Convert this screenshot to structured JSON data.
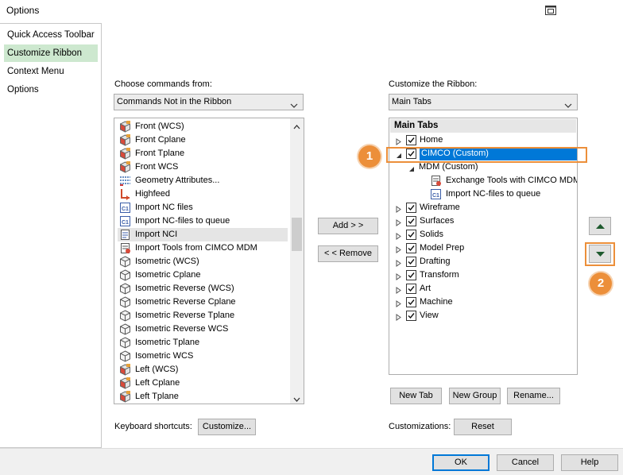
{
  "window": {
    "title": "Options"
  },
  "sidebar": {
    "items": [
      {
        "label": "Quick Access Toolbar",
        "selected": false
      },
      {
        "label": "Customize Ribbon",
        "selected": true
      },
      {
        "label": "Context Menu",
        "selected": false
      },
      {
        "label": "Options",
        "selected": false
      }
    ]
  },
  "left_panel": {
    "label": "Choose commands from:",
    "combo_value": "Commands Not in the Ribbon",
    "commands": [
      {
        "label": "Front (WCS)",
        "icon": "cube-red-icon"
      },
      {
        "label": "Front Cplane",
        "icon": "cube-red-icon"
      },
      {
        "label": "Front Tplane",
        "icon": "cube-red-icon"
      },
      {
        "label": "Front WCS",
        "icon": "cube-red-icon"
      },
      {
        "label": "Geometry Attributes...",
        "icon": "attributes-icon"
      },
      {
        "label": "Highfeed",
        "icon": "highfeed-icon"
      },
      {
        "label": "Import NC files",
        "icon": "nc-file-icon"
      },
      {
        "label": "Import NC-files to queue",
        "icon": "nc-file-icon"
      },
      {
        "label": "Import NCI",
        "icon": "nci-icon",
        "selected": true
      },
      {
        "label": "Import Tools from CIMCO MDM",
        "icon": "import-tools-icon"
      },
      {
        "label": "Isometric (WCS)",
        "icon": "cube-gray-icon"
      },
      {
        "label": "Isometric Cplane",
        "icon": "cube-gray-icon"
      },
      {
        "label": "Isometric Reverse (WCS)",
        "icon": "cube-gray-icon"
      },
      {
        "label": "Isometric Reverse Cplane",
        "icon": "cube-gray-icon"
      },
      {
        "label": "Isometric Reverse Tplane",
        "icon": "cube-gray-icon"
      },
      {
        "label": "Isometric Reverse WCS",
        "icon": "cube-gray-icon"
      },
      {
        "label": "Isometric Tplane",
        "icon": "cube-gray-icon"
      },
      {
        "label": "Isometric WCS",
        "icon": "cube-gray-icon"
      },
      {
        "label": "Left (WCS)",
        "icon": "cube-red-icon"
      },
      {
        "label": "Left Cplane",
        "icon": "cube-red-icon"
      },
      {
        "label": "Left Tplane",
        "icon": "cube-red-icon"
      }
    ],
    "keyboard_label": "Keyboard shortcuts:",
    "customize_button": "Customize..."
  },
  "middle": {
    "add_button": "Add > >",
    "remove_button": "< < Remove"
  },
  "right_panel": {
    "label": "Customize the Ribbon:",
    "combo_value": "Main Tabs",
    "tree_header": "Main Tabs",
    "tree": [
      {
        "label": "Home",
        "checked": true,
        "expand": "collapsed"
      },
      {
        "label": "CIMCO (Custom)",
        "checked": true,
        "expand": "expanded",
        "selected": true
      },
      {
        "label": "MDM (Custom)",
        "expand": "expanded"
      },
      {
        "label": "Exchange Tools with CIMCO MDM",
        "icon": "exchange-icon"
      },
      {
        "label": "Import NC-files to queue",
        "icon": "nc-file-icon"
      },
      {
        "label": "Wireframe",
        "checked": true,
        "expand": "collapsed"
      },
      {
        "label": "Surfaces",
        "checked": true,
        "expand": "collapsed"
      },
      {
        "label": "Solids",
        "checked": true,
        "expand": "collapsed"
      },
      {
        "label": "Model Prep",
        "checked": true,
        "expand": "collapsed"
      },
      {
        "label": "Drafting",
        "checked": true,
        "expand": "collapsed"
      },
      {
        "label": "Transform",
        "checked": true,
        "expand": "collapsed"
      },
      {
        "label": "Art",
        "checked": true,
        "expand": "collapsed"
      },
      {
        "label": "Machine",
        "checked": true,
        "expand": "collapsed"
      },
      {
        "label": "View",
        "checked": true,
        "expand": "collapsed"
      }
    ],
    "new_tab_button": "New Tab",
    "new_group_button": "New Group",
    "rename_button": "Rename...",
    "customizations_label": "Customizations:",
    "reset_button": "Reset"
  },
  "callouts": {
    "badge_1": "1",
    "badge_2": "2",
    "color": "#ec8f3a"
  },
  "footer": {
    "ok_button": "OK",
    "cancel_button": "Cancel",
    "help_button": "Help"
  },
  "colors": {
    "selection_blue": "#0078d7",
    "sidebar_selected": "#cde8cf",
    "accent_orange": "#ec8f3a"
  }
}
